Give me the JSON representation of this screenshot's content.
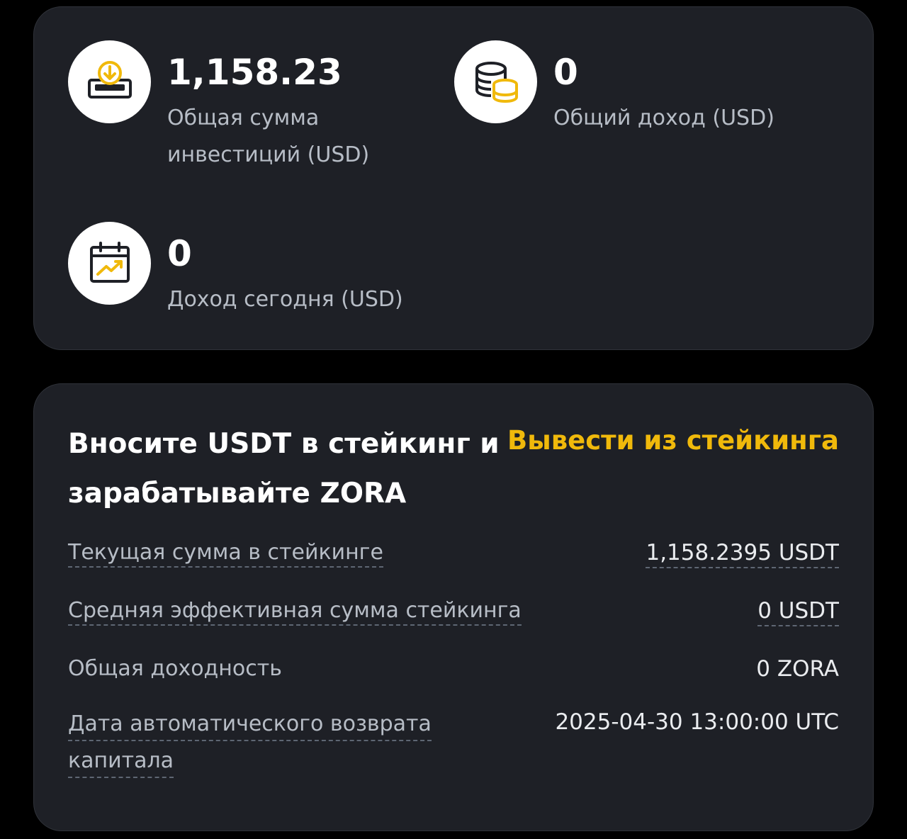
{
  "summary": {
    "total_invest": {
      "value": "1,158.23",
      "label_line1": "Общая сумма",
      "label_line2": "инвестиций (USD)",
      "icon": "download-tray-icon"
    },
    "total_income": {
      "value": "0",
      "label": "Общий доход (USD)",
      "icon": "coins-stack-icon"
    },
    "today_income": {
      "value": "0",
      "label": "Доход сегодня (USD)",
      "icon": "calendar-growth-icon"
    }
  },
  "staking": {
    "title": "Вносите USDT в стейкинг и зарабатывайте ZORA",
    "withdraw_link": "Вывести из стейкинга",
    "rows": [
      {
        "label": "Текущая сумма в стейкинге",
        "value": "1,158.2395 USDT"
      },
      {
        "label": "Средняя эффективная сумма стейкинга",
        "value": "0 USDT"
      },
      {
        "label": "Общая доходность",
        "value": "0 ZORA"
      },
      {
        "label_line1": "Дата автоматического возврата",
        "label_line2": "капитала",
        "value": "2025-04-30 13:00:00 UTC"
      }
    ]
  },
  "colors": {
    "background": "#000000",
    "card": "#1e2026",
    "accent": "#f0b90b",
    "text_primary": "#ffffff",
    "text_secondary": "#b7bdc6"
  }
}
